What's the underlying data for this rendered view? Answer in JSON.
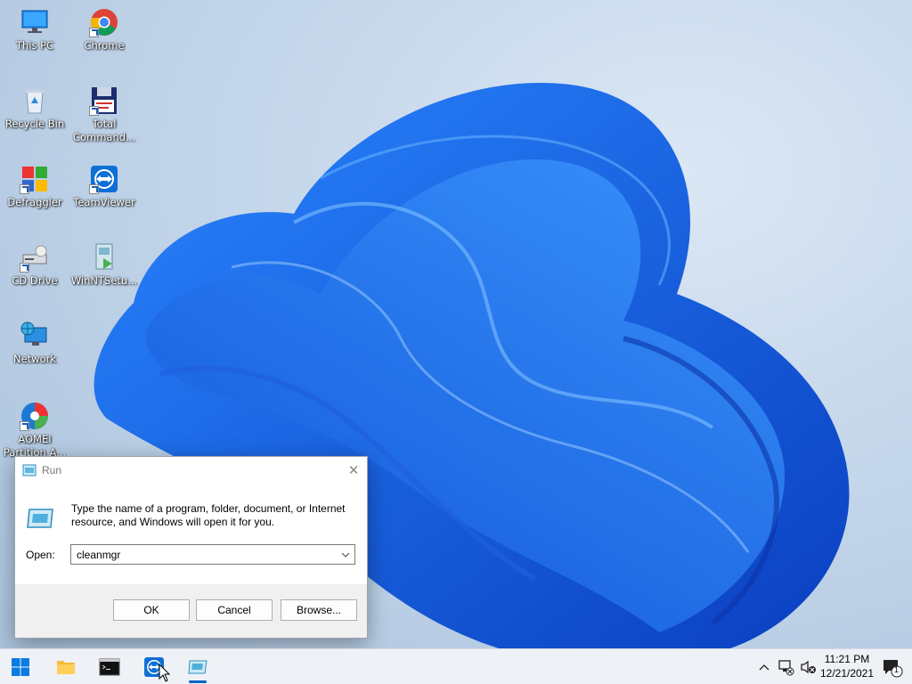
{
  "desktop": {
    "icons": [
      {
        "label": "This PC",
        "icon": "monitor-icon"
      },
      {
        "label": "Chrome",
        "icon": "chrome-icon"
      },
      {
        "label": "Recycle Bin",
        "icon": "recycle-bin-icon"
      },
      {
        "label": "Total Command...",
        "icon": "floppy-disk-icon"
      },
      {
        "label": "Defraggler",
        "icon": "defraggler-icon"
      },
      {
        "label": "TeamViewer",
        "icon": "teamviewer-icon"
      },
      {
        "label": "CD Drive",
        "icon": "cd-drive-icon"
      },
      {
        "label": "WinNTSetu...",
        "icon": "setup-icon"
      },
      {
        "label": "Network",
        "icon": "network-globe-icon"
      },
      {
        "label": "AOMEI Partition A...",
        "icon": "aomei-icon"
      }
    ]
  },
  "run_dialog": {
    "title": "Run",
    "description": "Type the name of a program, folder, document, or Internet resource, and Windows will open it for you.",
    "open_label": "Open:",
    "open_value": "cleanmgr",
    "ok_label": "OK",
    "cancel_label": "Cancel",
    "browse_label": "Browse..."
  },
  "taskbar": {
    "items": [
      "start-icon",
      "file-explorer-icon",
      "command-prompt-icon",
      "teamviewer-icon",
      "run-app-icon"
    ],
    "time": "11:21 PM",
    "date": "12/21/2021",
    "notification_count": "1"
  },
  "colors": {
    "accent": "#0067c0",
    "wallpaper_bloom": "#1a6ef0"
  }
}
